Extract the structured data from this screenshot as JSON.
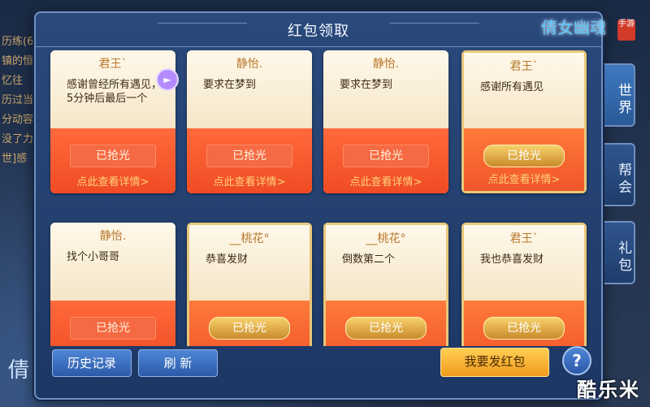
{
  "window": {
    "title": "红包领取"
  },
  "cards": [
    {
      "sender": "君王`",
      "message": "感谢曾经所有遇见，5分钟后最后一个",
      "status": "已抢光",
      "details": "点此查看详情>",
      "style": "plain"
    },
    {
      "sender": "静怡.",
      "message": "要求在梦到",
      "status": "已抢光",
      "details": "点此查看详情>",
      "style": "plain"
    },
    {
      "sender": "静怡.",
      "message": "要求在梦到",
      "status": "已抢光",
      "details": "点此查看详情>",
      "style": "plain"
    },
    {
      "sender": "君王`",
      "message": "感谢所有遇见",
      "status": "已抢光",
      "details": "点此查看详情>",
      "style": "gold"
    },
    {
      "sender": "静怡.",
      "message": "找个小哥哥",
      "status": "已抢光",
      "details": "",
      "style": "plain"
    },
    {
      "sender": "__桃花°",
      "message": "恭喜发财",
      "status": "已抢光",
      "details": "",
      "style": "gold"
    },
    {
      "sender": "__桃花°",
      "message": "倒数第二个",
      "status": "已抢光",
      "details": "",
      "style": "gold"
    },
    {
      "sender": "君王`",
      "message": "我也恭喜发财",
      "status": "已抢光",
      "details": "",
      "style": "gold"
    }
  ],
  "tabs": [
    {
      "label": "世界",
      "active": true
    },
    {
      "label": "帮会",
      "active": false
    },
    {
      "label": "礼包",
      "active": false
    }
  ],
  "buttons": {
    "history": "历史记录",
    "refresh": "刷 新",
    "send": "我要发红包",
    "help": "?"
  },
  "background": {
    "chat_lines": [
      "历练(6",
      "镇的恒",
      "忆往",
      "历过当",
      "分动容",
      "没了力",
      "世]感"
    ]
  },
  "logo": {
    "text": "倩女幽魂",
    "seal": "手游"
  },
  "watermark": "酷乐米",
  "colors": {
    "panel": "#1d3764",
    "card_bottom": "#f04b24",
    "gold_border": "#e8c77a",
    "sender": "#b7772b",
    "send_button": "#f09a1c"
  }
}
